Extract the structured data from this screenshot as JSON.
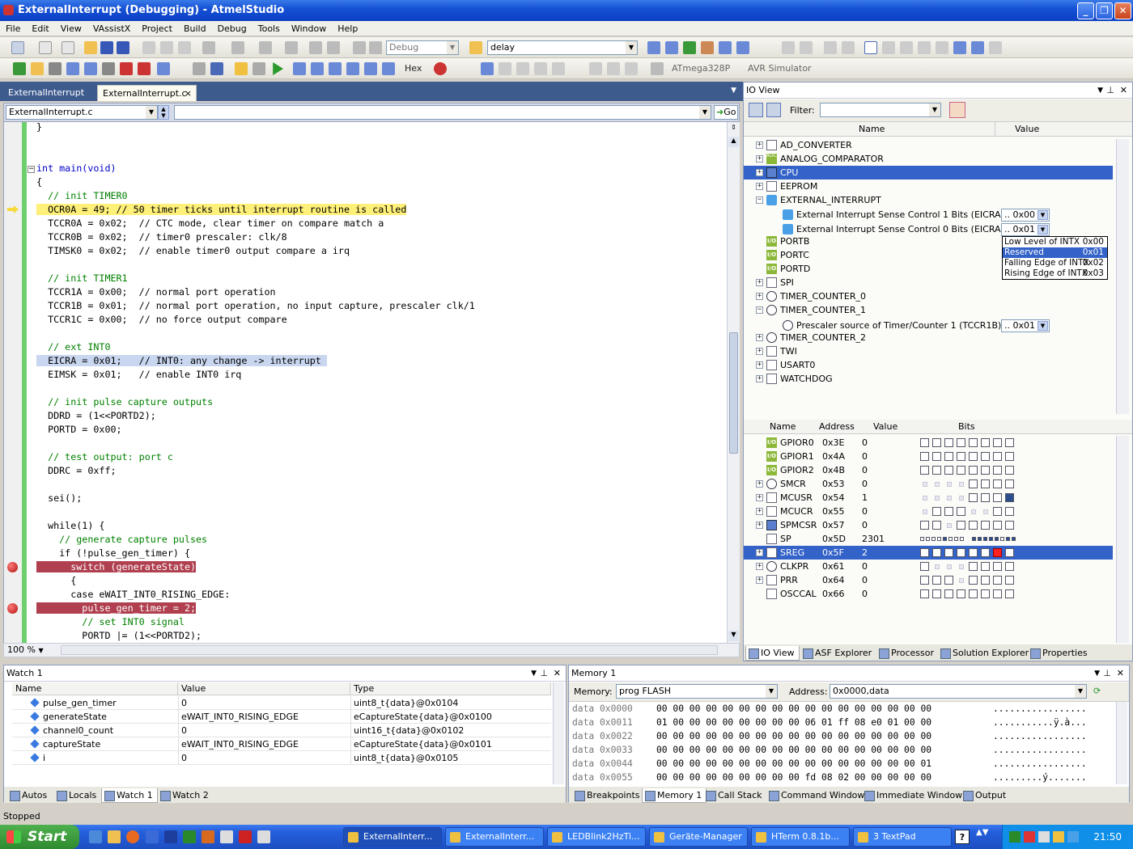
{
  "window": {
    "title": "ExternalInterrupt (Debugging) - AtmelStudio"
  },
  "menu": [
    "File",
    "Edit",
    "View",
    "VAssistX",
    "Project",
    "Build",
    "Debug",
    "Tools",
    "Window",
    "Help"
  ],
  "toolbar": {
    "config_combo": "Debug",
    "find_combo": "delay",
    "hex_label": "Hex",
    "device": "ATmega328P",
    "tool": "AVR Simulator"
  },
  "doc_tabs": [
    {
      "label": "ExternalInterrupt"
    },
    {
      "label": "ExternalInterrupt.c",
      "close": "×"
    }
  ],
  "editor": {
    "file_combo": "ExternalInterrupt.c",
    "go_label": "Go",
    "zoom": "100 %",
    "lines": [
      {
        "t": "}",
        "c": "pl"
      },
      {
        "t": "",
        "c": "pl"
      },
      {
        "t": "",
        "c": "pl"
      },
      {
        "t": "int main(void)",
        "c": "kw"
      },
      {
        "t": "{",
        "c": "pl"
      },
      {
        "t": "  // init TIMER0",
        "c": "cm"
      },
      {
        "t": "  OCR0A = 49; // 50 timer ticks until interrupt routine is called",
        "c": "pl",
        "hl": "yellow",
        "mark": "arrow"
      },
      {
        "t": "  TCCR0A = 0x02;  // CTC mode, clear timer on compare match a",
        "c": "pl"
      },
      {
        "t": "  TCCR0B = 0x02;  // timer0 prescaler: clk/8",
        "c": "pl"
      },
      {
        "t": "  TIMSK0 = 0x02;  // enable timer0 output compare a irq",
        "c": "pl"
      },
      {
        "t": "",
        "c": "pl"
      },
      {
        "t": "  // init TIMER1",
        "c": "cm"
      },
      {
        "t": "  TCCR1A = 0x00;  // normal port operation",
        "c": "pl"
      },
      {
        "t": "  TCCR1B = 0x01;  // normal port operation, no input capture, prescaler clk/1",
        "c": "pl"
      },
      {
        "t": "  TCCR1C = 0x00;  // no force output compare",
        "c": "pl"
      },
      {
        "t": "",
        "c": "pl"
      },
      {
        "t": "  // ext INT0",
        "c": "cm"
      },
      {
        "t": "  EICRA = 0x01;   // INT0: any change -> interrupt ",
        "c": "pl",
        "hl": "blue"
      },
      {
        "t": "  EIMSK = 0x01;   // enable INT0 irq",
        "c": "pl"
      },
      {
        "t": "",
        "c": "pl"
      },
      {
        "t": "  // init pulse capture outputs",
        "c": "cm"
      },
      {
        "t": "  DDRD = (1<<PORTD2);",
        "c": "pl"
      },
      {
        "t": "  PORTD = 0x00;",
        "c": "pl"
      },
      {
        "t": "",
        "c": "pl"
      },
      {
        "t": "  // test output: port c",
        "c": "cm"
      },
      {
        "t": "  DDRC = 0xff;",
        "c": "pl"
      },
      {
        "t": "",
        "c": "pl"
      },
      {
        "t": "  sei();",
        "c": "pl"
      },
      {
        "t": "",
        "c": "pl"
      },
      {
        "t": "  while(1) {",
        "c": "pl"
      },
      {
        "t": "    // generate capture pulses",
        "c": "cm"
      },
      {
        "t": "    if (!pulse_gen_timer) {",
        "c": "pl"
      },
      {
        "t": "      switch (generateState)",
        "c": "pl",
        "hl": "red",
        "mark": "bp"
      },
      {
        "t": "      {",
        "c": "pl"
      },
      {
        "t": "      case eWAIT_INT0_RISING_EDGE:",
        "c": "pl"
      },
      {
        "t": "        pulse_gen_timer = 2;",
        "c": "pl",
        "hl": "red",
        "mark": "bp"
      },
      {
        "t": "        // set INT0 signal",
        "c": "cm"
      },
      {
        "t": "        PORTD |= (1<<PORTD2);",
        "c": "pl"
      }
    ]
  },
  "ioview": {
    "title": "IO View",
    "filter_label": "Filter:",
    "filter_value": "",
    "col_name": "Name",
    "col_value": "Value",
    "tree": [
      {
        "label": "AD_CONVERTER",
        "icon": "doc",
        "exp": "+",
        "level": 0
      },
      {
        "label": "ANALOG_COMPARATOR",
        "icon": "adc",
        "exp": "+",
        "level": 0
      },
      {
        "label": "CPU",
        "icon": "cpu",
        "exp": "+",
        "level": 0,
        "sel": true
      },
      {
        "label": "EEPROM",
        "icon": "doc",
        "exp": "+",
        "level": 0
      },
      {
        "label": "EXTERNAL_INTERRUPT",
        "icon": "ext",
        "exp": "−",
        "level": 0
      },
      {
        "label": "External Interrupt Sense Control 1 Bits (EICRA)",
        "icon": "ext",
        "exp": "",
        "level": 1,
        "value": ".. 0x00"
      },
      {
        "label": "External Interrupt Sense Control 0 Bits (EICRA)",
        "icon": "ext",
        "exp": "",
        "level": 1,
        "value": ".. 0x01"
      },
      {
        "label": "PORTB",
        "icon": "io",
        "exp": "",
        "level": 0
      },
      {
        "label": "PORTC",
        "icon": "io",
        "exp": "",
        "level": 0
      },
      {
        "label": "PORTD",
        "icon": "io",
        "exp": "",
        "level": 0
      },
      {
        "label": "SPI",
        "icon": "doc",
        "exp": "+",
        "level": 0
      },
      {
        "label": "TIMER_COUNTER_0",
        "icon": "clock",
        "exp": "+",
        "level": 0
      },
      {
        "label": "TIMER_COUNTER_1",
        "icon": "clock",
        "exp": "−",
        "level": 0
      },
      {
        "label": "Prescaler source of Timer/Counter 1 (TCCR1B)",
        "icon": "clock",
        "exp": "",
        "level": 1,
        "value": ".. 0x01"
      },
      {
        "label": "TIMER_COUNTER_2",
        "icon": "clock",
        "exp": "+",
        "level": 0
      },
      {
        "label": "TWI",
        "icon": "doc",
        "exp": "+",
        "level": 0
      },
      {
        "label": "USART0",
        "icon": "doc",
        "exp": "+",
        "level": 0
      },
      {
        "label": "WATCHDOG",
        "icon": "doc",
        "exp": "+",
        "level": 0
      }
    ],
    "dropdown": [
      {
        "label": "Low Level of INTX",
        "value": "0x00"
      },
      {
        "label": "Reserved",
        "value": "0x01",
        "sel": true
      },
      {
        "label": "Falling Edge of INTX",
        "value": "0x02"
      },
      {
        "label": "Rising Edge of INTX",
        "value": "0x03"
      }
    ],
    "reg_headers": {
      "name": "Name",
      "address": "Address",
      "value": "Value",
      "bits": "Bits"
    },
    "registers": [
      {
        "name": "GPIOR0",
        "addr": "0x3E",
        "value": "0",
        "icon": "io",
        "exp": "",
        "bits": "00000000"
      },
      {
        "name": "GPIOR1",
        "addr": "0x4A",
        "value": "0",
        "icon": "io",
        "exp": "",
        "bits": "00000000"
      },
      {
        "name": "GPIOR2",
        "addr": "0x4B",
        "value": "0",
        "icon": "io",
        "exp": "",
        "bits": "00000000"
      },
      {
        "name": "SMCR",
        "addr": "0x53",
        "value": "0",
        "icon": "clock",
        "exp": "+",
        "bits": "dddd0000"
      },
      {
        "name": "MCUSR",
        "addr": "0x54",
        "value": "1",
        "icon": "doc",
        "exp": "+",
        "bits": "dddd0001"
      },
      {
        "name": "MCUCR",
        "addr": "0x55",
        "value": "0",
        "icon": "doc",
        "exp": "+",
        "bits": "d000dd00"
      },
      {
        "name": "SPMCSR",
        "addr": "0x57",
        "value": "0",
        "icon": "cpu",
        "exp": "+",
        "bits": "00d00000"
      },
      {
        "name": "SP",
        "addr": "0x5D",
        "value": "2301",
        "icon": "doc",
        "exp": "",
        "bits": "sp"
      },
      {
        "name": "SREG",
        "addr": "0x5F",
        "value": "2",
        "icon": "doc",
        "exp": "+",
        "bits": "00000010",
        "sel": true
      },
      {
        "name": "CLKPR",
        "addr": "0x61",
        "value": "0",
        "icon": "clock",
        "exp": "+",
        "bits": "0ddd0000"
      },
      {
        "name": "PRR",
        "addr": "0x64",
        "value": "0",
        "icon": "doc",
        "exp": "+",
        "bits": "000d0000"
      },
      {
        "name": "OSCCAL",
        "addr": "0x66",
        "value": "0",
        "icon": "doc",
        "exp": "",
        "bits": "00000000"
      }
    ],
    "tabs": [
      "IO View",
      "ASF Explorer",
      "Processor",
      "Solution Explorer",
      "Properties"
    ]
  },
  "watch": {
    "title": "Watch 1",
    "headers": [
      "Name",
      "Value",
      "Type"
    ],
    "rows": [
      {
        "name": "pulse_gen_timer",
        "value": "0",
        "type": "uint8_t{data}@0x0104"
      },
      {
        "name": "generateState",
        "value": "eWAIT_INT0_RISING_EDGE",
        "type": "eCaptureState{data}@0x0100"
      },
      {
        "name": "channel0_count",
        "value": "0",
        "type": "uint16_t{data}@0x0102"
      },
      {
        "name": "captureState",
        "value": "eWAIT_INT0_RISING_EDGE",
        "type": "eCaptureState{data}@0x0101"
      },
      {
        "name": "i",
        "value": "0",
        "type": "uint8_t{data}@0x0105"
      }
    ],
    "tabs": [
      "Autos",
      "Locals",
      "Watch 1",
      "Watch 2"
    ]
  },
  "memory": {
    "title": "Memory 1",
    "memory_label": "Memory:",
    "memory_value": "prog FLASH",
    "address_label": "Address:",
    "address_value": "0x0000,data",
    "lines": [
      {
        "addr": "data 0x0000",
        "bytes": "00 00 00 00 00 00 00 00 00 00 00 00 00 00 00 00 00",
        "ascii": "................."
      },
      {
        "addr": "data 0x0011",
        "bytes": "01 00 00 00 00 00 00 00 00 06 01 ff 08 e0 01 00 00",
        "ascii": "...........ÿ.à..."
      },
      {
        "addr": "data 0x0022",
        "bytes": "00 00 00 00 00 00 00 00 00 00 00 00 00 00 00 00 00",
        "ascii": "................."
      },
      {
        "addr": "data 0x0033",
        "bytes": "00 00 00 00 00 00 00 00 00 00 00 00 00 00 00 00 00",
        "ascii": "................."
      },
      {
        "addr": "data 0x0044",
        "bytes": "00 00 00 00 00 00 00 00 00 00 00 00 00 00 00 00 01",
        "ascii": "................."
      },
      {
        "addr": "data 0x0055",
        "bytes": "00 00 00 00 00 00 00 00 00 fd 08 02 00 00 00 00 00",
        "ascii": ".........ý......."
      }
    ],
    "tabs": [
      "Breakpoints",
      "Memory 1",
      "Call Stack",
      "Command Window",
      "Immediate Window",
      "Output"
    ]
  },
  "status": "Stopped",
  "taskbar": {
    "start": "Start",
    "tasks": [
      "ExternalInterr...",
      "ExternalInterr...",
      "LEDBlink2HzTi...",
      "Geräte-Manager",
      "HTerm 0.8.1b...",
      "3 TextPad"
    ],
    "clock": "21:50"
  }
}
